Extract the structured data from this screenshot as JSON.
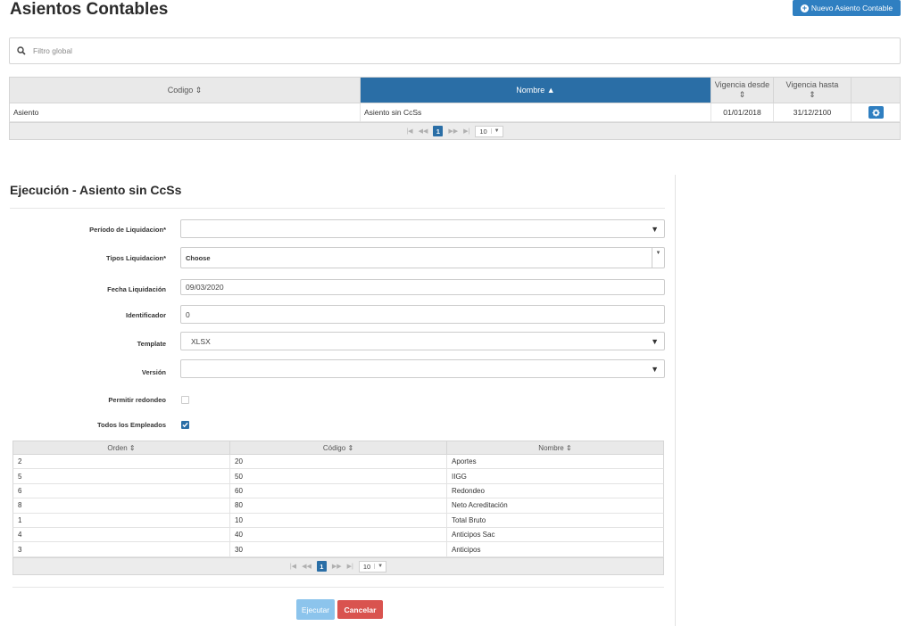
{
  "header": {
    "title": "Asientos Contables",
    "new_button_label": "Nuevo Asiento Contable"
  },
  "filter": {
    "placeholder": "Filtro global",
    "icon": "search-icon"
  },
  "top_table": {
    "columns": [
      "Codigo",
      "Nombre",
      "Vigencia desde",
      "Vigencia hasta"
    ],
    "sorted_column": "Nombre",
    "rows": [
      {
        "codigo": "Asiento",
        "nombre": "Asiento sin CcSs",
        "desde": "01/01/2018",
        "hasta": "31/12/2100"
      }
    ],
    "pager": {
      "current_page": "1",
      "page_size": "10"
    }
  },
  "execution": {
    "title": "Ejecución - Asiento sin CcSs",
    "fields": {
      "periodo_label": "Período de Liquidacion*",
      "periodo_value": "",
      "tipos_label": "Tipos Liquidacion*",
      "tipos_value": "Choose",
      "fecha_label": "Fecha Liquidación",
      "fecha_value": "09/03/2020",
      "identificador_label": "Identificador",
      "identificador_value": "0",
      "template_label": "Template",
      "template_value": "XLSX",
      "version_label": "Versión",
      "version_value": "",
      "redondeo_label": "Permitir redondeo",
      "redondeo_checked": false,
      "todos_label": "Todos los Empleados",
      "todos_checked": true
    },
    "table": {
      "columns": [
        "Orden",
        "Código",
        "Nombre"
      ],
      "rows": [
        {
          "orden": "2",
          "codigo": "20",
          "nombre": "Aportes"
        },
        {
          "orden": "5",
          "codigo": "50",
          "nombre": "IIGG"
        },
        {
          "orden": "6",
          "codigo": "60",
          "nombre": "Redondeo"
        },
        {
          "orden": "8",
          "codigo": "80",
          "nombre": "Neto Acreditación"
        },
        {
          "orden": "1",
          "codigo": "10",
          "nombre": "Total Bruto"
        },
        {
          "orden": "4",
          "codigo": "40",
          "nombre": "Anticipos Sac"
        },
        {
          "orden": "3",
          "codigo": "30",
          "nombre": "Anticipos"
        }
      ],
      "pager": {
        "current_page": "1",
        "page_size": "10"
      }
    },
    "buttons": {
      "execute": "Ejecutar",
      "cancel": "Cancelar"
    }
  },
  "colors": {
    "primary": "#2f7fc1",
    "header_active": "#2a6ea6",
    "danger": "#d9534f",
    "execute_disabled": "#8cc4ec"
  }
}
